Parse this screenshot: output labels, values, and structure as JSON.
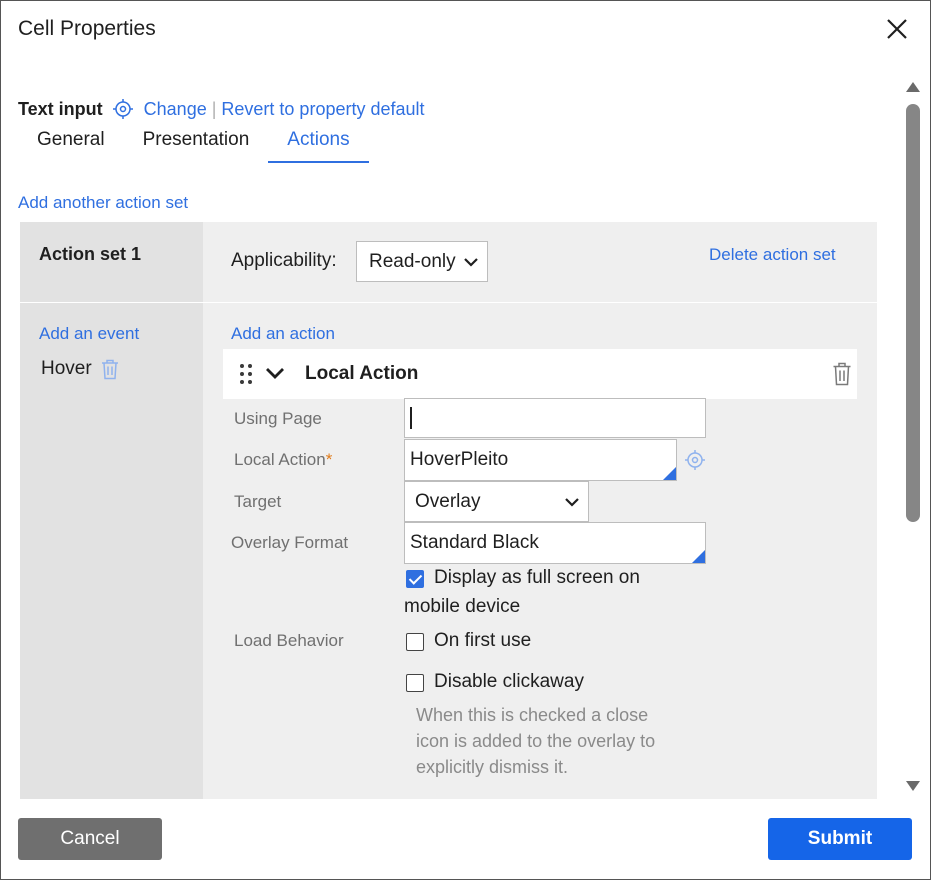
{
  "dialog": {
    "title": "Cell Properties"
  },
  "field": {
    "type": "Text input",
    "change_label": "Change",
    "separator": "|",
    "revert_label": "Revert to property default"
  },
  "tabs": [
    {
      "label": "General",
      "active": false
    },
    {
      "label": "Presentation",
      "active": false
    },
    {
      "label": "Actions",
      "active": true
    }
  ],
  "actions_tab": {
    "add_action_set_label": "Add another action set",
    "action_set": {
      "title": "Action set 1",
      "applicability_label": "Applicability:",
      "applicability_value": "Read-only",
      "delete_label": "Delete action set",
      "add_event_label": "Add an event",
      "events": [
        {
          "name": "Hover"
        }
      ],
      "add_action_label": "Add an action",
      "action": {
        "title": "Local Action",
        "using_page_label": "Using Page",
        "using_page_value": "",
        "local_action_label": "Local Action",
        "required_mark": "*",
        "local_action_value": "HoverPleito",
        "target_label": "Target",
        "target_value": "Overlay",
        "overlay_format_label": "Overlay Format",
        "overlay_format_value": "Standard Black",
        "full_screen_label_line1": "Display as full screen on",
        "full_screen_label_line2": "mobile device",
        "full_screen_checked": true,
        "load_behavior_label": "Load Behavior",
        "on_first_use_label": "On first use",
        "on_first_use_checked": false,
        "disable_clickaway_label": "Disable clickaway",
        "disable_clickaway_checked": false,
        "disable_clickaway_help": "When this is checked a close icon is added to the overlay to explicitly dismiss it."
      }
    }
  },
  "footer": {
    "cancel_label": "Cancel",
    "submit_label": "Submit"
  },
  "colors": {
    "link": "#2f6fe0",
    "primary": "#1565e8",
    "secondary_button": "#6f6f6f",
    "required": "#e07b1a"
  }
}
